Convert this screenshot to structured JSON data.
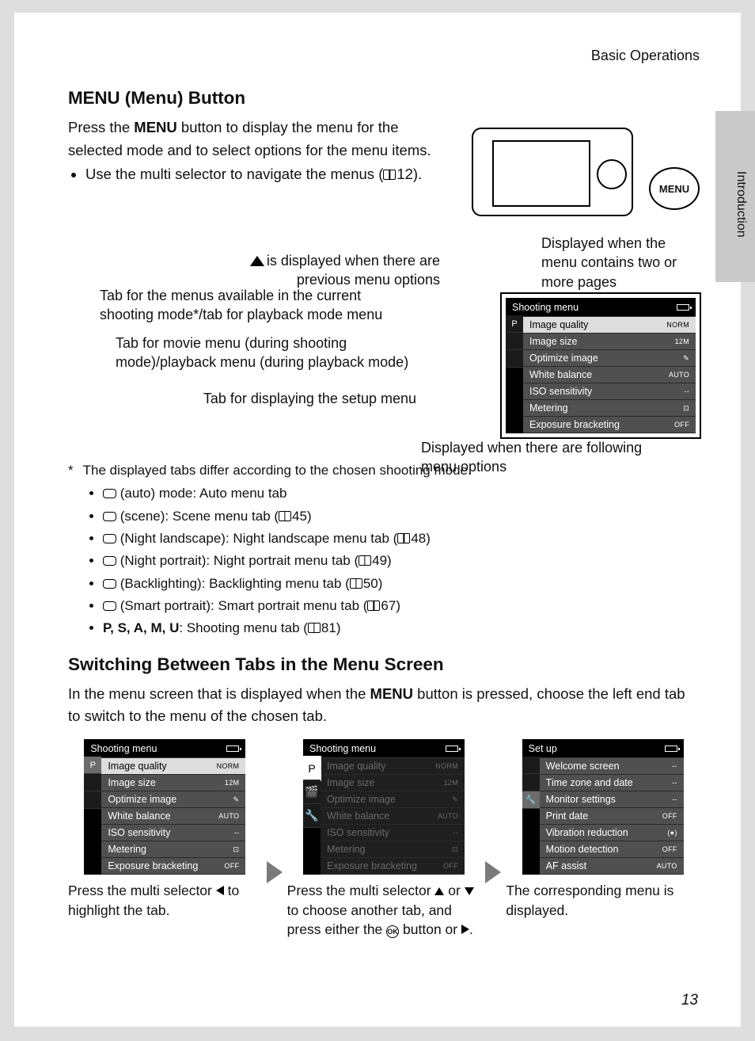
{
  "header": {
    "section": "Basic Operations",
    "sidetab": "Introduction",
    "page_no": "13"
  },
  "h1": {
    "menu": "MENU",
    "rest": "(Menu) Button"
  },
  "intro": {
    "p1a": "Press the ",
    "p1menu": "MENU",
    "p1b": " button to display the menu for the selected mode and to select options for the menu items.",
    "li1": "Use the multi selector to navigate the menus (",
    "li1page": "12)."
  },
  "menu_button_label": "MENU",
  "annot": {
    "r1": " is displayed when there are previous menu options",
    "r2": "Displayed when the menu contains two or more pages",
    "l1": "Tab for the menus available in the current shooting mode*/tab for playback mode menu",
    "l2": "Tab for movie menu (during shooting mode)/playback menu (during playback mode)",
    "l3": "Tab for displaying the setup menu",
    "b1": "Displayed when there are following menu options"
  },
  "main_menu": {
    "title": "Shooting menu",
    "tabs": [
      "P",
      "",
      ""
    ],
    "items": [
      {
        "l": "Image quality",
        "v": "NORM",
        "sel": true
      },
      {
        "l": "Image size",
        "v": "12M"
      },
      {
        "l": "Optimize image",
        "v": "✎"
      },
      {
        "l": "White balance",
        "v": "AUTO"
      },
      {
        "l": "ISO sensitivity",
        "v": "--"
      },
      {
        "l": "Metering",
        "v": "⊡"
      },
      {
        "l": "Exposure bracketing",
        "v": "OFF"
      }
    ]
  },
  "note": {
    "lead": "The displayed tabs differ according to the chosen shooting mode.",
    "items": [
      {
        "t": " (auto) mode: Auto menu tab"
      },
      {
        "t": " (scene): Scene menu tab (",
        "pg": "45)"
      },
      {
        "t": " (Night landscape): Night landscape menu tab (",
        "pg": "48)"
      },
      {
        "t": " (Night portrait): Night portrait menu tab (",
        "pg": "49)"
      },
      {
        "t": " (Backlighting): Backlighting menu tab (",
        "pg": "50)"
      },
      {
        "t": " (Smart portrait): Smart portrait menu tab (",
        "pg": "67)"
      },
      {
        "pre": "P, S, A, M, U",
        "t": ": Shooting menu tab (",
        "pg": "81)"
      }
    ]
  },
  "h2": "Switching Between Tabs in the Menu Screen",
  "p2a": "In the menu screen that is displayed when the ",
  "p2menu": "MENU",
  "p2b": " button is pressed, choose the left end tab to switch to the menu of the chosen tab.",
  "steps": {
    "s1": {
      "title": "Shooting menu",
      "caption_a": "Press the multi selector ",
      "caption_b": " to highlight the tab."
    },
    "s2": {
      "title": "Shooting menu",
      "caption_a": "Press the multi selector ",
      "caption_b": " or ",
      "caption_c": " to choose another tab, and press either the ",
      "caption_d": " button or "
    },
    "s3": {
      "title": "Set up",
      "caption": "The corresponding menu is displayed.",
      "items": [
        {
          "l": "Welcome screen",
          "v": "--"
        },
        {
          "l": "Time zone and date",
          "v": "--"
        },
        {
          "l": "Monitor settings",
          "v": "--"
        },
        {
          "l": "Print date",
          "v": "OFF"
        },
        {
          "l": "Vibration reduction",
          "v": "(●)"
        },
        {
          "l": "Motion detection",
          "v": "OFF"
        },
        {
          "l": "AF assist",
          "v": "AUTO"
        }
      ]
    }
  },
  "ok_label": "OK"
}
